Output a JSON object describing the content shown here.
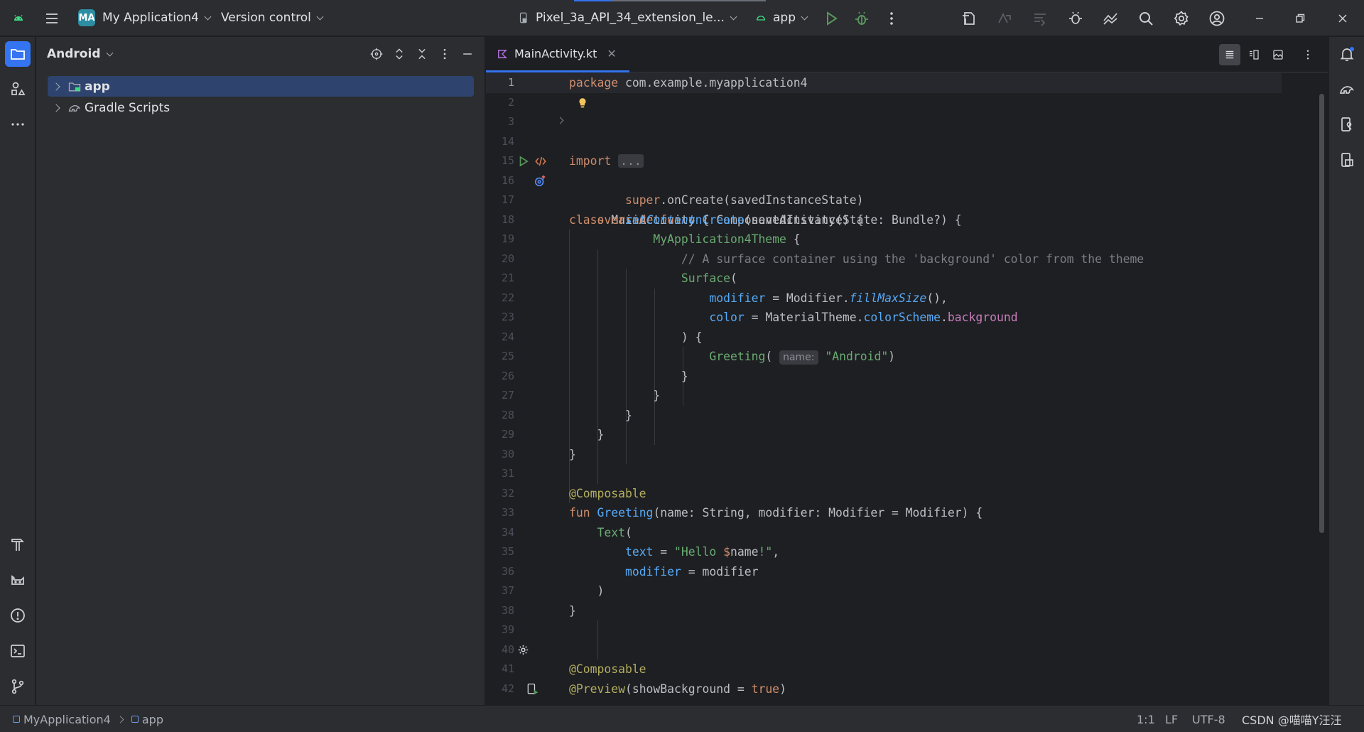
{
  "titlebar": {
    "project_badge": "MA",
    "project_name": "My Application4",
    "vcs_label": "Version control",
    "device": "Pixel_3a_API_34_extension_le...",
    "run_config": "app",
    "build_progress": 0.2
  },
  "project_panel": {
    "view_label": "Android",
    "tree": [
      {
        "label": "app",
        "selected": true
      },
      {
        "label": "Gradle Scripts",
        "selected": false
      }
    ]
  },
  "editor": {
    "tab_label": "MainActivity.kt",
    "param_hint": "name:",
    "fold_placeholder": "...",
    "line_numbers": [
      "1",
      "2",
      "3",
      "14",
      "15",
      "16",
      "17",
      "18",
      "19",
      "20",
      "21",
      "22",
      "23",
      "24",
      "25",
      "26",
      "27",
      "28",
      "29",
      "30",
      "31",
      "32",
      "33",
      "34",
      "35",
      "36",
      "37",
      "38",
      "39",
      "40",
      "41",
      "42"
    ]
  },
  "statusbar": {
    "breadcrumb_root": "MyApplication4",
    "breadcrumb_module": "app",
    "position": "1:1",
    "line_sep": "LF",
    "encoding": "UTF-8",
    "watermark": "CSDN @喵喵Y汪汪"
  },
  "colors": {
    "accent": "#3574f0",
    "keyword": "#cf8e6d",
    "function": "#56a8f5",
    "string": "#6aab73",
    "annotation": "#b3ae60"
  }
}
